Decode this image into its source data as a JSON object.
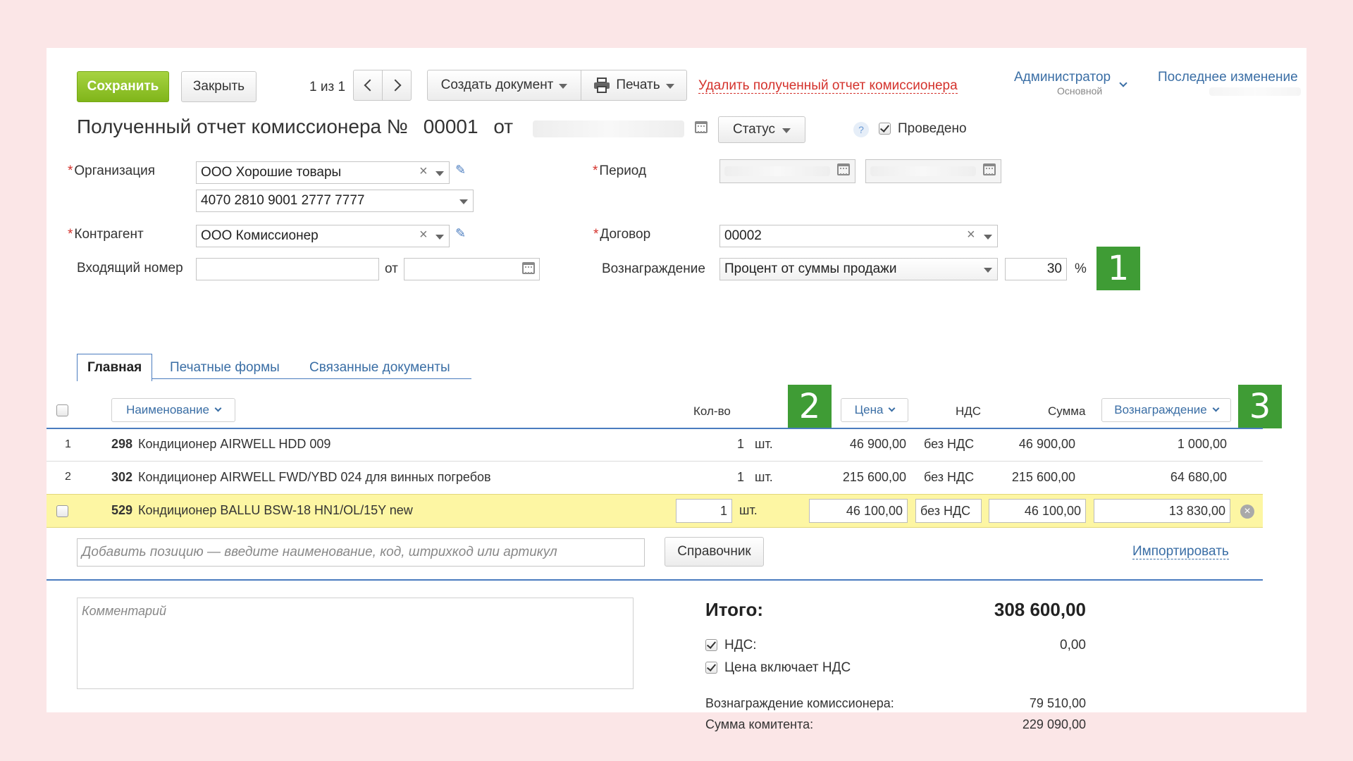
{
  "toolbar": {
    "save": "Сохранить",
    "close": "Закрыть",
    "pager": "1 из 1",
    "create_document": "Создать документ",
    "print": "Печать",
    "delete_link": "Удалить полученный отчет комиссионера"
  },
  "user": {
    "name": "Администратор",
    "role": "Основной",
    "last_change": "Последнее изменение"
  },
  "doc": {
    "title": "Полученный отчет комиссионера №",
    "number": "00001",
    "from": "от",
    "status": "Статус",
    "help": "?",
    "posted": "Проведено"
  },
  "form": {
    "org_label": "Организация",
    "org_value": "ООО Хорошие товары",
    "account_value": "4070 2810 9001 2777 7777",
    "contractor_label": "Контрагент",
    "contractor_value": "ООО Комиссионер",
    "incoming_label": "Входящий номер",
    "incoming_from": "от",
    "period_label": "Период",
    "contract_label": "Договор",
    "contract_value": "00002",
    "reward_label": "Вознаграждение",
    "reward_type": "Процент от суммы продажи",
    "reward_percent": "30",
    "percent_sign": "%"
  },
  "badges": [
    "1",
    "2",
    "3"
  ],
  "tabs": [
    "Главная",
    "Печатные формы",
    "Связанные документы"
  ],
  "table": {
    "headers": {
      "name": "Наименование",
      "qty": "Кол-во",
      "price": "Цена",
      "vat": "НДС",
      "sum": "Сумма",
      "reward": "Вознаграждение"
    },
    "rows": [
      {
        "idx": "1",
        "code": "298",
        "name": "Кондиционер AIRWELL HDD 009",
        "qty": "1",
        "unit": "шт.",
        "price": "46 900,00",
        "vat": "без НДС",
        "sum": "46 900,00",
        "reward": "1 000,00"
      },
      {
        "idx": "2",
        "code": "302",
        "name": "Кондиционер AIRWELL FWD/YBD 024 для винных погребов",
        "qty": "1",
        "unit": "шт.",
        "price": "215 600,00",
        "vat": "без НДС",
        "sum": "215 600,00",
        "reward": "64 680,00"
      },
      {
        "idx": "",
        "code": "529",
        "name": "Кондиционер BALLU BSW-18 HN1/OL/15Y new",
        "qty": "1",
        "unit": "шт.",
        "price": "46 100,00",
        "vat": "без НДС",
        "sum": "46 100,00",
        "reward": "13 830,00"
      }
    ],
    "add_placeholder": "Добавить позицию — введите наименование, код, штрихкод или артикул",
    "catalog": "Справочник",
    "import": "Импортировать"
  },
  "comment_placeholder": "Комментарий",
  "totals": {
    "total_label": "Итого:",
    "total_value": "308 600,00",
    "vat_label": "НДС:",
    "vat_value": "0,00",
    "price_incl_vat": "Цена включает НДС",
    "commission_label": "Вознаграждение комиссионера:",
    "commission_value": "79 510,00",
    "principal_label": "Сумма комитента:",
    "principal_value": "229 090,00"
  },
  "colors": {
    "accent_green": "#80b51a",
    "badge_green": "#3f9c35",
    "link_blue": "#3a6ea5",
    "danger_red": "#d4322c",
    "highlight_row": "#fdf6a3"
  }
}
